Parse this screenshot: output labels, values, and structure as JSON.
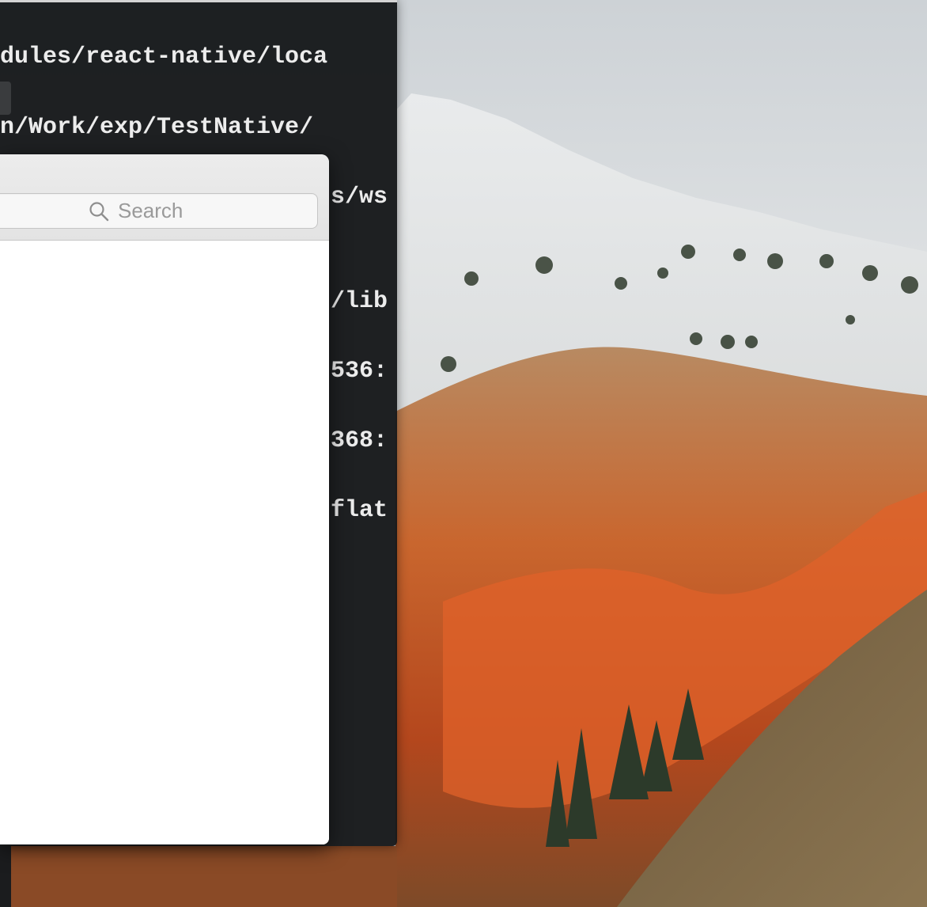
{
  "terminal": {
    "lines": [
      "dules/react-native/loca",
      "n/Work/exp/TestNative/",
      "s/ws",
      "/lib",
      "536:",
      "368:",
      "flat"
    ]
  },
  "search": {
    "placeholder": "Search",
    "value": ""
  },
  "icons": {
    "search": "search-icon"
  }
}
